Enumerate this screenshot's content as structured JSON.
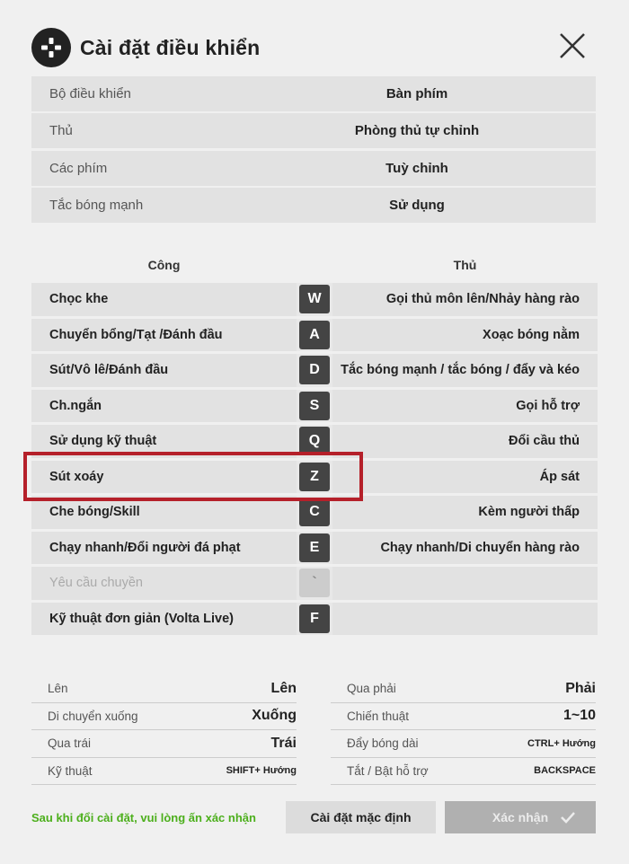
{
  "header": {
    "title": "Cài đặt điều khiển"
  },
  "settings": [
    {
      "label": "Bộ điều khiển",
      "value": "Bàn phím"
    },
    {
      "label": "Thủ",
      "value": "Phòng thủ tự chỉnh"
    },
    {
      "label": "Các phím",
      "value": "Tuỳ chỉnh"
    },
    {
      "label": "Tắc bóng mạnh",
      "value": "Sử dụng"
    }
  ],
  "keymap": {
    "attack_header": "Công",
    "defense_header": "Thủ",
    "rows": [
      {
        "attack": "Chọc khe",
        "key": "W",
        "defense": "Gọi thủ môn lên/Nhảy hàng rào"
      },
      {
        "attack": "Chuyển bổng/Tạt /Đánh đầu",
        "key": "A",
        "defense": "Xoạc bóng nằm"
      },
      {
        "attack": "Sút/Vô lê/Đánh đầu",
        "key": "D",
        "defense": "Tắc bóng mạnh / tắc bóng / đẩy và kéo"
      },
      {
        "attack": "Ch.ngắn",
        "key": "S",
        "defense": "Gọi hỗ trợ"
      },
      {
        "attack": "Sử dụng kỹ thuật",
        "key": "Q",
        "defense": "Đổi cầu thủ"
      },
      {
        "attack": "Sút xoáy",
        "key": "Z",
        "defense": "Áp sát"
      },
      {
        "attack": "Che bóng/Skill",
        "key": "C",
        "defense": "Kèm người thấp"
      },
      {
        "attack": "Chạy nhanh/Đổi người đá phạt",
        "key": "E",
        "defense": "Chạy nhanh/Di chuyển hàng rào"
      },
      {
        "attack": "Yêu cầu chuyền",
        "key": "`",
        "defense": ""
      },
      {
        "attack": "Kỹ thuật đơn giản (Volta Live)",
        "key": "F",
        "defense": ""
      }
    ]
  },
  "movement": {
    "left": [
      {
        "label": "Lên",
        "value": "Lên"
      },
      {
        "label": "Di chuyển xuống",
        "value": "Xuống"
      },
      {
        "label": "Qua trái",
        "value": "Trái"
      },
      {
        "label": "Kỹ thuật",
        "value": "SHIFT+ Hướng"
      }
    ],
    "right": [
      {
        "label": "Qua phải",
        "value": "Phải"
      },
      {
        "label": "Chiến thuật",
        "value": "1~10"
      },
      {
        "label": "Đẩy bóng dài",
        "value": "CTRL+ Hướng"
      },
      {
        "label": "Tắt / Bật hỗ trợ",
        "value": "BACKSPACE"
      }
    ]
  },
  "footer": {
    "note": "Sau khi đổi cài đặt, vui lòng ấn xác nhận",
    "default_button": "Cài đặt mặc định",
    "confirm_button": "Xác nhận"
  },
  "colors": {
    "highlight": "#b5202a",
    "note": "#4caf1c",
    "key": "#444444"
  }
}
